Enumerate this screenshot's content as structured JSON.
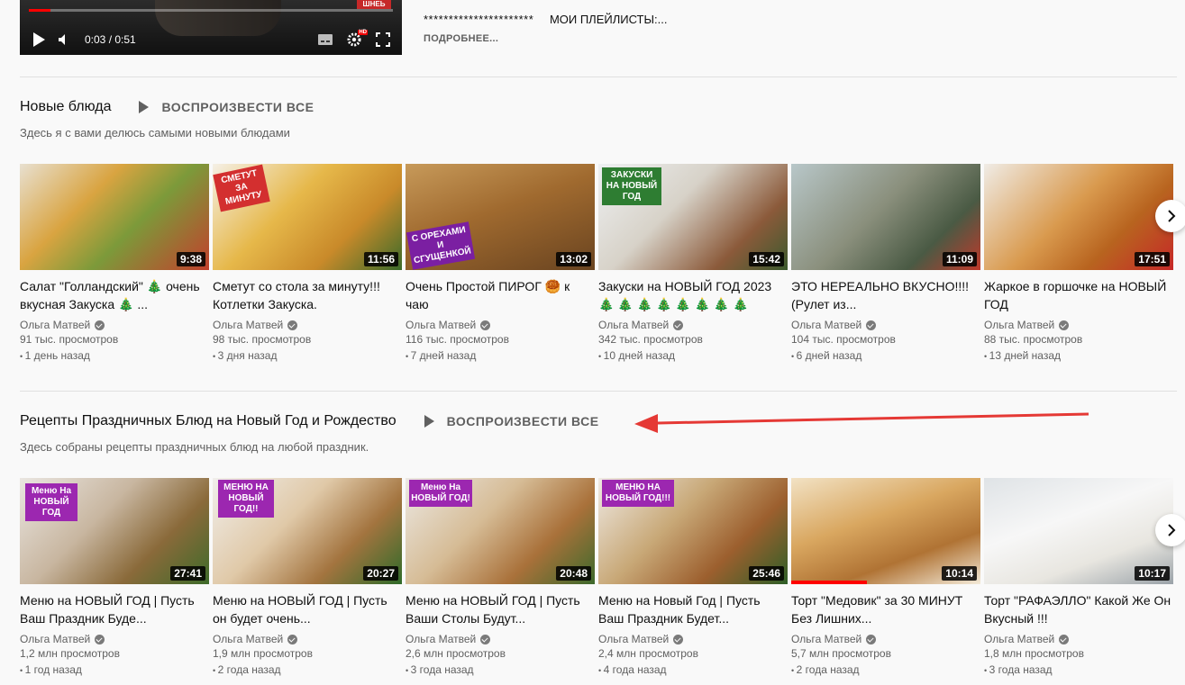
{
  "player": {
    "badge": "ШНЕЬ",
    "time": "0:03 / 0:51",
    "hd": "HD",
    "progress_percent": 6
  },
  "description": {
    "stars": "**********************",
    "playlists": "МОИ ПЛЕЙЛИСТЫ:...",
    "more": "ПОДРОБНЕЕ..."
  },
  "shelves": [
    {
      "title": "Новые блюда",
      "play_all": "ВОСПРОИЗВЕСТИ ВСЕ",
      "subtitle": "Здесь я с вами делюсь самыми новыми блюдами",
      "videos": [
        {
          "title": "Салат \"Голландский\" 🎄 очень вкусная Закуска 🎄 ...",
          "duration": "9:38",
          "channel": "Ольга Матвей",
          "views": "91 тыс. просмотров",
          "age": "1 день назад",
          "thumb_label": ""
        },
        {
          "title": "Сметут со стола за минуту!!! Котлетки Закуска.",
          "duration": "11:56",
          "channel": "Ольга Матвей",
          "views": "98 тыс. просмотров",
          "age": "3 дня назад",
          "thumb_label": "СМЕТУТ ЗА МИНУТУ"
        },
        {
          "title": "Очень Простой ПИРОГ 🥮 к чаю",
          "duration": "13:02",
          "channel": "Ольга Матвей",
          "views": "116 тыс. просмотров",
          "age": "7 дней назад",
          "thumb_label": "С ОРЕХАМИ И СГУЩЕНКОЙ"
        },
        {
          "title": "Закуски на НОВЫЙ ГОД 2023 🎄 🎄 🎄 🎄 🎄 🎄 🎄 🎄",
          "duration": "15:42",
          "channel": "Ольга Матвей",
          "views": "342 тыс. просмотров",
          "age": "10 дней назад",
          "thumb_label": "ЗАКУСКИ НА НОВЫЙ ГОД"
        },
        {
          "title": "ЭТО НЕРЕАЛЬНО ВКУСНО!!!! (Рулет из...",
          "duration": "11:09",
          "channel": "Ольга Матвей",
          "views": "104 тыс. просмотров",
          "age": "6 дней назад",
          "thumb_label": ""
        },
        {
          "title": "Жаркое в горшочке на НОВЫЙ ГОД",
          "duration": "17:51",
          "channel": "Ольга Матвей",
          "views": "88 тыс. просмотров",
          "age": "13 дней назад",
          "thumb_label": ""
        }
      ]
    },
    {
      "title": "Рецепты Праздничных Блюд на Новый Год и Рождество",
      "play_all": "ВОСПРОИЗВЕСТИ ВСЕ",
      "subtitle": "Здесь собраны рецепты праздничных блюд на любой праздник.",
      "videos": [
        {
          "title": "Меню на НОВЫЙ ГОД | Пусть Ваш Праздник Буде...",
          "duration": "27:41",
          "channel": "Ольга Матвей",
          "views": "1,2 млн просмотров",
          "age": "1 год назад",
          "thumb_label": "Меню На НОВЫЙ ГОД"
        },
        {
          "title": "Меню на НОВЫЙ ГОД | Пусть он будет очень...",
          "duration": "20:27",
          "channel": "Ольга Матвей",
          "views": "1,9 млн просмотров",
          "age": "2 года назад",
          "thumb_label": "МЕНЮ НА НОВЫЙ ГОД!!"
        },
        {
          "title": "Меню на НОВЫЙ ГОД | Пусть Ваши Столы Будут...",
          "duration": "20:48",
          "channel": "Ольга Матвей",
          "views": "2,6 млн просмотров",
          "age": "3 года назад",
          "thumb_label": "Меню На НОВЫЙ ГОД!"
        },
        {
          "title": "Меню на Новый Год | Пусть Ваш Праздник Будет...",
          "duration": "25:46",
          "channel": "Ольга Матвей",
          "views": "2,4 млн просмотров",
          "age": "4 года назад",
          "thumb_label": "МЕНЮ НА НОВЫЙ ГОД!!!"
        },
        {
          "title": "Торт \"Медовик\" за 30 МИНУТ Без Лишних...",
          "duration": "10:14",
          "channel": "Ольга Матвей",
          "views": "5,7 млн просмотров",
          "age": "2 года назад",
          "thumb_label": ""
        },
        {
          "title": "Торт \"РАФАЭЛЛО\" Какой Же Он Вкусный !!!",
          "duration": "10:17",
          "channel": "Ольга Матвей",
          "views": "1,8 млн просмотров",
          "age": "3 года назад",
          "thumb_label": ""
        }
      ]
    }
  ],
  "colors": {
    "accent_red": "#e53935",
    "text_primary": "#0f0f0f",
    "text_secondary": "#606060",
    "thumb_label_purple": "#9c27b0"
  }
}
